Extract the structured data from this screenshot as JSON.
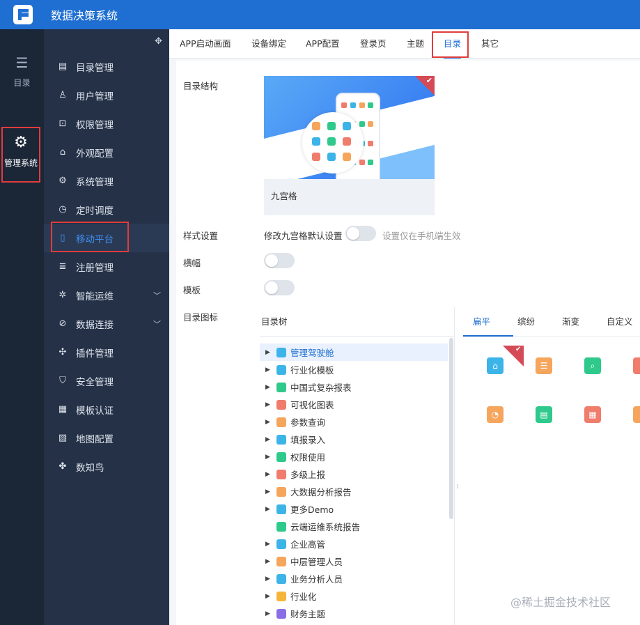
{
  "header": {
    "title": "数据决策系统",
    "logo_icon": "finereport-logo"
  },
  "leftnav": {
    "items": [
      {
        "label": "目录",
        "icon": "list-icon"
      },
      {
        "label": "管理系统",
        "icon": "gear-icon"
      }
    ]
  },
  "sidebar": {
    "pin_icon": "pin-icon",
    "items": [
      {
        "label": "目录管理",
        "icon": "catalog-icon"
      },
      {
        "label": "用户管理",
        "icon": "user-icon"
      },
      {
        "label": "权限管理",
        "icon": "lock-icon"
      },
      {
        "label": "外观配置",
        "icon": "brush-icon"
      },
      {
        "label": "系统管理",
        "icon": "settings-icon"
      },
      {
        "label": "定时调度",
        "icon": "clock-icon"
      },
      {
        "label": "移动平台",
        "icon": "mobile-icon"
      },
      {
        "label": "注册管理",
        "icon": "register-icon"
      },
      {
        "label": "智能运维",
        "icon": "network-icon"
      },
      {
        "label": "数据连接",
        "icon": "link-icon"
      },
      {
        "label": "插件管理",
        "icon": "puzzle-icon"
      },
      {
        "label": "安全管理",
        "icon": "shield-icon"
      },
      {
        "label": "模板认证",
        "icon": "template-icon"
      },
      {
        "label": "地图配置",
        "icon": "map-icon"
      },
      {
        "label": "数知鸟",
        "icon": "bird-icon"
      }
    ],
    "active": "移动平台"
  },
  "tabs": [
    "APP启动画面",
    "设备绑定",
    "APP配置",
    "登录页",
    "主题",
    "目录",
    "其它"
  ],
  "active_tab": "目录",
  "form": {
    "structure_label": "目录结构",
    "structure_caption": "九宫格",
    "style_label": "样式设置",
    "style_switch_label": "修改九宫格默认设置",
    "style_note": "设置仅在手机端生效",
    "banner_label": "横幅",
    "template_label": "模板",
    "icon_label": "目录图标"
  },
  "tree": {
    "header": "目录树",
    "items": [
      {
        "label": "管理驾驶舱",
        "color": "#3cb4e8",
        "expandable": true,
        "selected": true
      },
      {
        "label": "行业化模板",
        "color": "#3cb4e8",
        "expandable": true
      },
      {
        "label": "中国式复杂报表",
        "color": "#2fc98b",
        "expandable": true
      },
      {
        "label": "可视化图表",
        "color": "#f07c6c",
        "expandable": true
      },
      {
        "label": "参数查询",
        "color": "#f6a55c",
        "expandable": true
      },
      {
        "label": "填报录入",
        "color": "#3cb4e8",
        "expandable": true
      },
      {
        "label": "权限使用",
        "color": "#2fc98b",
        "expandable": true
      },
      {
        "label": "多级上报",
        "color": "#f07c6c",
        "expandable": true
      },
      {
        "label": "大数据分析报告",
        "color": "#f6a55c",
        "expandable": true
      },
      {
        "label": "更多Demo",
        "color": "#3cb4e8",
        "expandable": true
      },
      {
        "label": "云端运维系统报告",
        "color": "#2fc98b",
        "expandable": false
      },
      {
        "label": "企业高管",
        "color": "#3cb4e8",
        "expandable": true
      },
      {
        "label": "中层管理人员",
        "color": "#f6a55c",
        "expandable": true
      },
      {
        "label": "业务分析人员",
        "color": "#3cb4e8",
        "expandable": true
      },
      {
        "label": "行业化",
        "color": "#f6b53a",
        "expandable": true
      },
      {
        "label": "财务主题",
        "color": "#8b6ee6",
        "expandable": true
      }
    ]
  },
  "picker": {
    "tabs": [
      "扁平",
      "缤纷",
      "渐变",
      "自定义"
    ],
    "active_tab": "扁平",
    "icons": [
      {
        "name": "dashboard-icon",
        "color": "#3cb4e8",
        "selected": true
      },
      {
        "name": "report-icon",
        "color": "#f6a55c"
      },
      {
        "name": "search-report-icon",
        "color": "#2fc98b"
      },
      {
        "name": "chart-icon",
        "color": "#f07c6c"
      },
      {
        "name": "pie-icon",
        "color": "#f6a55c"
      },
      {
        "name": "document-icon",
        "color": "#2fc98b"
      },
      {
        "name": "form-icon",
        "color": "#f07c6c"
      },
      {
        "name": "upload-icon",
        "color": "#f6a55c"
      }
    ]
  },
  "watermark": "@稀土掘金技术社区"
}
